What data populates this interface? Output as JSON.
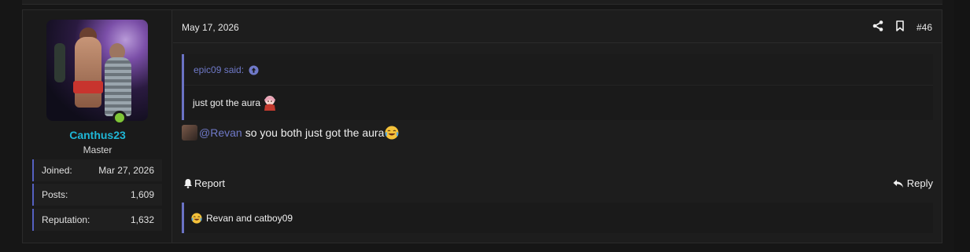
{
  "user": {
    "username": "Canthus23",
    "title": "Master",
    "stats": [
      {
        "label": "Joined:",
        "value": "Mar 27, 2026"
      },
      {
        "label": "Posts:",
        "value": "1,609"
      },
      {
        "label": "Reputation:",
        "value": "1,632"
      }
    ]
  },
  "post": {
    "date": "May 17, 2026",
    "number": "#46",
    "quote": {
      "author": "epic09 said:",
      "text": "just got the aura"
    },
    "reply": {
      "mention": "@Revan",
      "text": "so you both just got the aura"
    },
    "actions": {
      "report": "Report",
      "reply": "Reply"
    },
    "reactions": "Revan and catboy09"
  },
  "colors": {
    "accent": "#6a72c4",
    "username": "#1fb6d6",
    "online": "#7fc637",
    "background": "#1d1d1d"
  }
}
